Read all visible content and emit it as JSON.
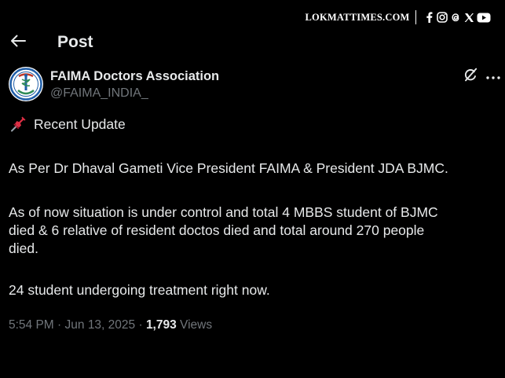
{
  "watermark": {
    "text": "LOKMATTIMES.COM",
    "icons": [
      "facebook-icon",
      "instagram-icon",
      "threads-icon",
      "x-icon",
      "youtube-icon"
    ]
  },
  "topbar": {
    "back_icon": "arrow-left-icon",
    "title": "Post"
  },
  "author": {
    "name": "FAIMA Doctors Association",
    "handle": "@FAIMA_INDIA_"
  },
  "actions": {
    "grok_icon": "grok-icon",
    "more_icon": "more-icon"
  },
  "post": {
    "pin_emoji": "pushpin-icon",
    "heading": "Recent Update",
    "paragraph1": "As Per Dr Dhaval Gameti Vice President FAIMA & President JDA BJMC.",
    "paragraph2_line1": "As of now situation is under control and total 4 MBBS student of BJMC",
    "paragraph2_line2": "died & 6 relative of resident doctos died and total around 270 people",
    "paragraph2_line3": "died.",
    "paragraph3": "24 student undergoing treatment right now."
  },
  "meta": {
    "time": "5:54 PM",
    "sep1": " · ",
    "date": "Jun 13, 2025",
    "sep2": " · ",
    "views_count": "1,793",
    "views_label": " Views"
  },
  "colors": {
    "background": "#000000",
    "primary_text": "#e7e9ea",
    "secondary_text": "#71767b"
  }
}
